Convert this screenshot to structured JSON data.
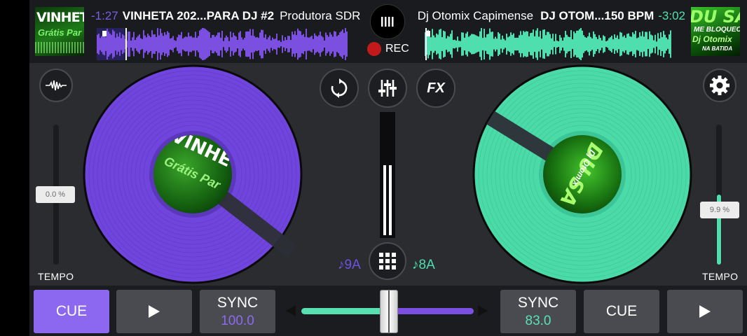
{
  "left_deck": {
    "time_remaining": "-1:27",
    "title": "VINHETA 202...PARA DJ #2",
    "artist": "Produtora SDR",
    "cover_text": [
      "VINHET",
      "Grátis Par"
    ],
    "pitch": "0.0 %",
    "pitch_fraction": 0.5,
    "tempo_label": "TEMPO",
    "key": "♪9A",
    "cue_label": "CUE",
    "sync_label": "SYNC",
    "bpm": "100.0",
    "color": "#7b4fe0"
  },
  "right_deck": {
    "time_remaining": "-3:02",
    "title": "DJ OTOM...150 BPM",
    "artist": "Dj Otomix Capimense",
    "cover_text": [
      "DU SA",
      "ME BLOQUEO",
      "Dj Otomix",
      "NA BATIDA"
    ],
    "pitch": "9.9 %",
    "pitch_fraction": 0.3,
    "tempo_label": "TEMPO",
    "key": "♪8A",
    "cue_label": "CUE",
    "sync_label": "SYNC",
    "bpm": "83.0",
    "color": "#4fdfae"
  },
  "center": {
    "rec_label": "REC",
    "fx_label": "FX",
    "rec_color": "#c21a1a"
  },
  "icons": {
    "library": "library-bars-icon",
    "waveform": "waveform-icon",
    "loop": "loop-icon",
    "mixer": "mixer-sliders-icon",
    "fx": "fx-icon",
    "settings": "gear-icon",
    "pads": "grid-icon",
    "play": "play-icon"
  }
}
